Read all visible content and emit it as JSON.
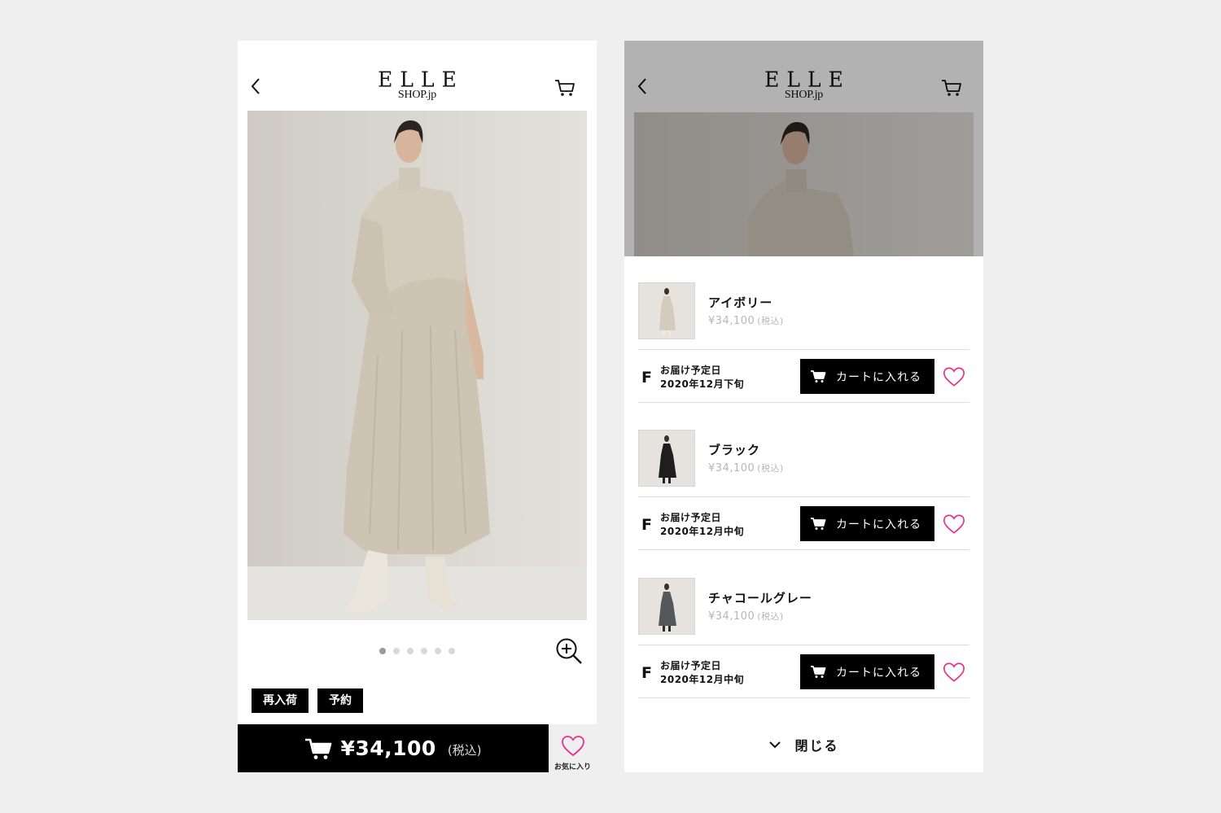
{
  "header": {
    "back_icon": "chevron-left-icon",
    "logo_main": "ELLE",
    "logo_sub": "SHOP.jp",
    "cart_icon": "cart-icon"
  },
  "product": {
    "carousel_pages": 6,
    "carousel_active": 1,
    "zoom_icon": "zoom-in-icon",
    "tags": [
      "再入荷",
      "予約"
    ],
    "price": "¥34,100",
    "tax_label": "(税込)",
    "favorite_label": "お気に入り"
  },
  "variant_sheet": {
    "variants": [
      {
        "name": "アイボリー",
        "price": "¥34,100",
        "tax": "(税込)",
        "size": "F",
        "shipping_label": "お届け予定日",
        "shipping_date": "2020年12月下旬",
        "cart_label": "カートに入れる"
      },
      {
        "name": "ブラック",
        "price": "¥34,100",
        "tax": "(税込)",
        "size": "F",
        "shipping_label": "お届け予定日",
        "shipping_date": "2020年12月中旬",
        "cart_label": "カートに入れる"
      },
      {
        "name": "チャコールグレー",
        "price": "¥34,100",
        "tax": "(税込)",
        "size": "F",
        "shipping_label": "お届け予定日",
        "shipping_date": "2020年12月中旬",
        "cart_label": "カートに入れる"
      }
    ],
    "close_label": "閉じる"
  },
  "colors": {
    "accent_heart": "#e8308c",
    "dress_ivory": "#d3cbbc",
    "dress_black": "#1e1e1e",
    "dress_charcoal": "#55585a",
    "page_bg": "#efefef"
  }
}
